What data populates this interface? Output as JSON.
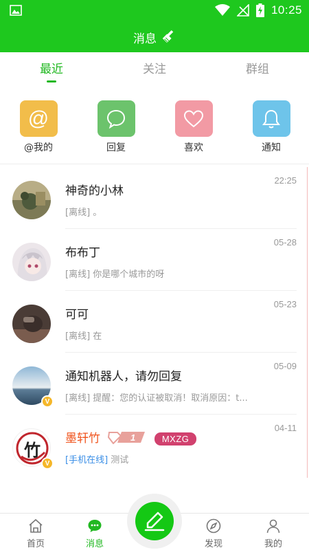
{
  "status_bar": {
    "time": "10:25"
  },
  "app_bar": {
    "title": "消息"
  },
  "tabs": [
    {
      "label": "最近",
      "active": true
    },
    {
      "label": "关注",
      "active": false
    },
    {
      "label": "群组",
      "active": false
    }
  ],
  "actions": [
    {
      "label": "@我的",
      "glyph": "@",
      "color": "#f2bd4a"
    },
    {
      "label": "回复",
      "color": "#6cc36c"
    },
    {
      "label": "喜欢",
      "color": "#f29aa4"
    },
    {
      "label": "通知",
      "color": "#6ec4ea"
    }
  ],
  "conversations": [
    {
      "name": "神奇的小林",
      "date": "22:25",
      "status": "[离线]",
      "message": "。"
    },
    {
      "name": "布布丁",
      "date": "05-28",
      "status": "[离线]",
      "message": "你是哪个城市的呀"
    },
    {
      "name": "可可",
      "date": "05-23",
      "status": "[离线]",
      "message": "在"
    },
    {
      "name": "通知机器人，请勿回复",
      "date": "05-09",
      "status": "[离线]",
      "message": "提醒：您的认证被取消！取消原因：t...",
      "badge": "V"
    },
    {
      "name": "墨轩竹",
      "date": "04-11",
      "status": "[手机在线]",
      "message": "测试",
      "badge": "V",
      "level": "1",
      "tag": "MXZG",
      "avatar_char": "竹"
    }
  ],
  "bottom_nav": [
    {
      "label": "首页",
      "icon": "home-icon"
    },
    {
      "label": "消息",
      "icon": "chat-icon",
      "active": true
    },
    {
      "label": "发现",
      "icon": "compass-icon"
    },
    {
      "label": "我的",
      "icon": "user-icon"
    }
  ],
  "colors": {
    "primary": "#1ec81e",
    "active_text": "#21b821",
    "vip_name": "#f0541e",
    "online": "#3a8ee6",
    "tag": "#d1416e"
  }
}
